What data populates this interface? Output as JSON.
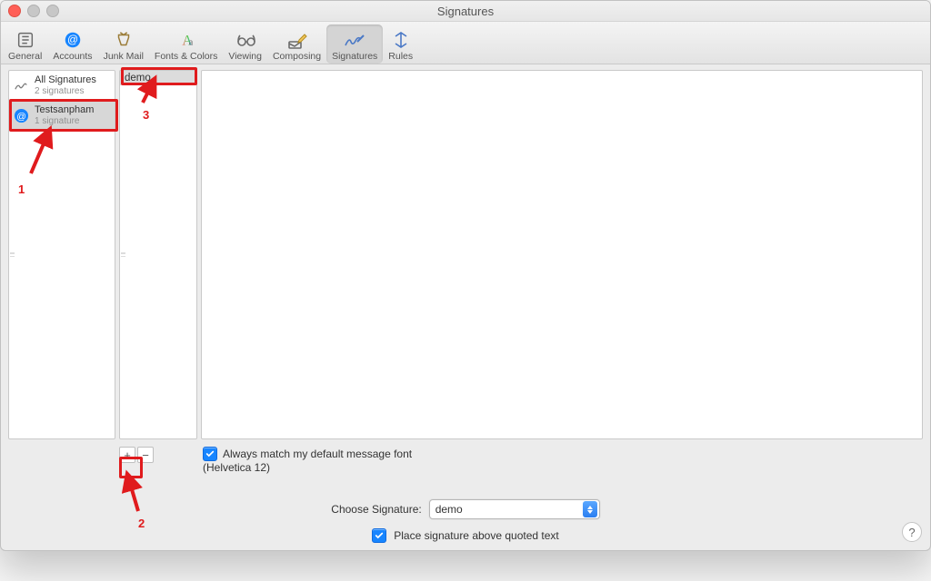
{
  "window": {
    "title": "Signatures"
  },
  "toolbar": {
    "items": [
      {
        "id": "general",
        "label": "General"
      },
      {
        "id": "accounts",
        "label": "Accounts"
      },
      {
        "id": "junk",
        "label": "Junk Mail"
      },
      {
        "id": "fonts",
        "label": "Fonts & Colors"
      },
      {
        "id": "viewing",
        "label": "Viewing"
      },
      {
        "id": "composing",
        "label": "Composing"
      },
      {
        "id": "signatures",
        "label": "Signatures",
        "selected": true
      },
      {
        "id": "rules",
        "label": "Rules"
      }
    ]
  },
  "accounts_pane": {
    "items": [
      {
        "name": "All Signatures",
        "sub": "2 signatures",
        "icon": "all"
      },
      {
        "name": "Testsanpham",
        "sub": "1 signature",
        "icon": "account",
        "selected": true
      }
    ]
  },
  "signatures_pane": {
    "items": [
      {
        "name": "demo",
        "selected": true
      }
    ],
    "add_label": "+",
    "remove_label": "−"
  },
  "editor": {
    "match_font_label": "Always match my default message font",
    "match_font_checked": true,
    "font_detail": "(Helvetica 12)"
  },
  "footer": {
    "choose_label": "Choose Signature:",
    "choose_value": "demo",
    "place_above_label": "Place signature above quoted text",
    "place_above_checked": true
  },
  "annotations": {
    "n1": "1",
    "n2": "2",
    "n3": "3"
  }
}
